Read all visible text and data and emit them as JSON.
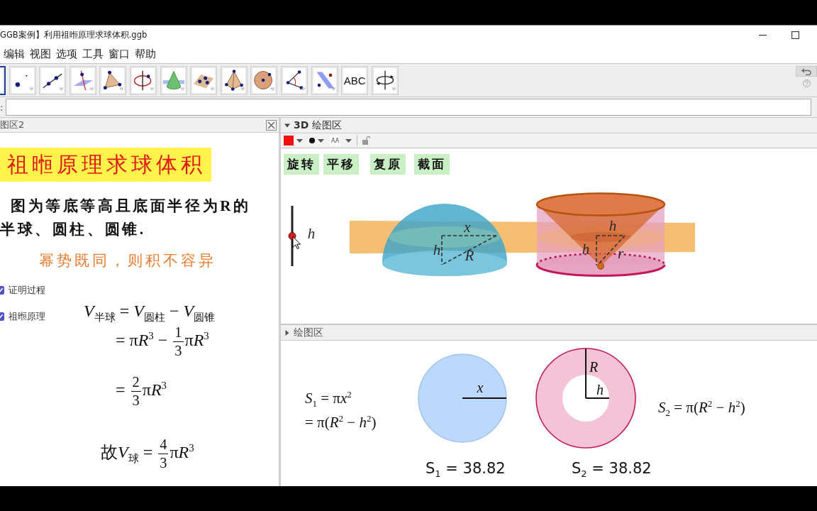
{
  "window": {
    "title": "GGB案例】利用祖暅原理求球体积.ggb"
  },
  "menu": [
    "编辑",
    "视图",
    "选项",
    "工具",
    "窗口",
    "帮助"
  ],
  "toolbar": {
    "tools": [
      {
        "selected": true
      },
      {
        "kind": "point",
        "selected": false
      },
      {
        "kind": "line",
        "selected": false
      },
      {
        "kind": "perpendicular",
        "selected": false
      },
      {
        "kind": "polygon",
        "selected": false
      },
      {
        "kind": "circle-axis",
        "selected": false
      },
      {
        "kind": "cone",
        "selected": false
      },
      {
        "kind": "plane",
        "selected": false
      },
      {
        "kind": "pyramid",
        "selected": false
      },
      {
        "kind": "sphere",
        "selected": false
      },
      {
        "kind": "angle",
        "selected": false
      },
      {
        "kind": "reflect",
        "selected": false
      },
      {
        "kind": "text",
        "label": "ABC",
        "selected": false
      },
      {
        "kind": "rotate",
        "selected": false
      }
    ]
  },
  "input_bar": {
    "label": ":"
  },
  "graphics_2": {
    "title": "图区2",
    "heading": "祖暅原理求球体积",
    "description_lines": [
      "图为等底等高且底面半径为R的",
      "半球、圆柱、圆锥."
    ],
    "motto": "幂势既同，则积不容异",
    "checkboxes": [
      {
        "label": "证明过程",
        "checked": true
      },
      {
        "label": "祖暅原理",
        "checked": true
      }
    ],
    "formulas": [
      [
        {
          "kind": "var",
          "text": "V$_{半球}$"
        },
        {
          "kind": "text",
          "text": " = "
        },
        {
          "kind": "var",
          "text": "V$_{圆柱}$"
        },
        {
          "kind": "text",
          "text": " − "
        },
        {
          "kind": "var",
          "text": "V$_{圆锥}$"
        }
      ],
      [
        {
          "kind": "text",
          "text": "= π"
        },
        {
          "kind": "var",
          "text": "R$^{3}$"
        },
        {
          "kind": "text",
          "text": " − "
        },
        {
          "kind": "frac",
          "num": "1",
          "den": "3"
        },
        {
          "kind": "text",
          "text": "π"
        },
        {
          "kind": "var",
          "text": "R$^{3}$"
        }
      ],
      [
        {
          "kind": "text",
          "text": "= "
        },
        {
          "kind": "frac",
          "num": "2",
          "den": "3"
        },
        {
          "kind": "text",
          "text": "π"
        },
        {
          "kind": "var",
          "text": "R$^{3}$"
        }
      ],
      [
        {
          "kind": "text",
          "text": "故"
        },
        {
          "kind": "var",
          "text": "V$_{球}$"
        },
        {
          "kind": "text",
          "text": " = "
        },
        {
          "kind": "frac",
          "num": "4",
          "den": "3"
        },
        {
          "kind": "text",
          "text": "π"
        },
        {
          "kind": "var",
          "text": "R$^{3}$"
        }
      ]
    ]
  },
  "view_3d": {
    "title": "**3D** 绘图区",
    "style_bar_open": true,
    "label_style": "AA",
    "buttons": [
      "旋转",
      "平移",
      "复原",
      "截面"
    ],
    "slider": {
      "label": "h",
      "level": 0.5
    },
    "hemisphere_labels": [
      "x",
      "h",
      "R"
    ],
    "cylinder_labels": [
      "h",
      "h",
      "r"
    ]
  },
  "view_2d": {
    "title": "绘图区",
    "style_bar_open": false,
    "formula_left": [
      [
        {
          "kind": "var",
          "text": "S$_{1}$"
        },
        {
          "kind": "text",
          "text": " = π"
        },
        {
          "kind": "var",
          "text": "x$^{2}$"
        }
      ],
      [
        {
          "kind": "text",
          "text": "= π("
        },
        {
          "kind": "var",
          "text": "R$^{2}$"
        },
        {
          "kind": "text",
          "text": " − "
        },
        {
          "kind": "var",
          "text": "h$^{2}$"
        },
        {
          "kind": "text",
          "text": ")"
        }
      ]
    ],
    "disc_label": "x",
    "ring_labels": [
      "R",
      "h"
    ],
    "formula_right": [
      {
        "kind": "var",
        "text": "S$_{2}$"
      },
      {
        "kind": "text",
        "text": " = π("
      },
      {
        "kind": "var",
        "text": "R$^{2}$"
      },
      {
        "kind": "text",
        "text": " − "
      },
      {
        "kind": "var",
        "text": "h$^{2}$"
      },
      {
        "kind": "text",
        "text": ")"
      }
    ],
    "readouts": [
      "S$_{1}$ = 38.82",
      "S$_{2}$ = 38.82"
    ]
  }
}
